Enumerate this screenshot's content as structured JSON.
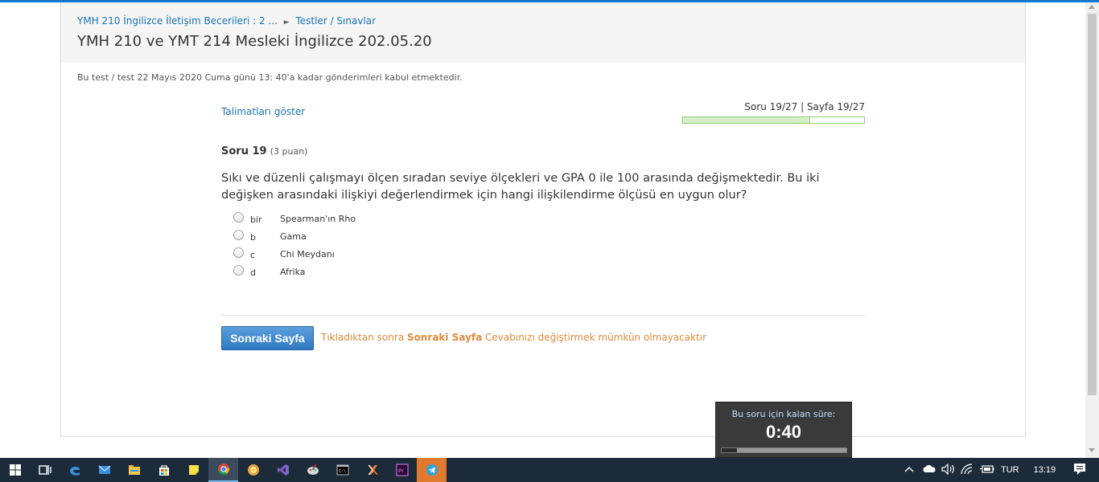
{
  "breadcrumb": {
    "course": "YMH 210 İngilizce İletişim Becerileri : 2 ...",
    "separator": "►",
    "section": "Testler / Sınavlar"
  },
  "page_title": "YMH 210 ve YMT 214 Mesleki İngilizce 202.05.20",
  "notice": "Bu test / test 22 Mayıs 2020 Cuma günü 13: 40'a kadar gönderimleri kabul etmektedir.",
  "instructions_link": "Talimatları göster",
  "progress": {
    "label": "Soru 19/27 | Sayfa 19/27",
    "fraction": 0.7037
  },
  "question": {
    "number_label": "Soru 19",
    "points_label": "(3 puan)",
    "text": "Sıkı ve düzenli çalışmayı ölçen sıradan seviye ölçekleri ve GPA 0 ile 100 arasında değişmektedir. Bu iki değişken arasındaki ilişkiyi değerlendirmek için hangi ilişkilendirme ölçüsü en uygun olur?",
    "options": [
      {
        "letter": "bir",
        "text": "Spearman'ın Rho"
      },
      {
        "letter": "b",
        "text": "Gama"
      },
      {
        "letter": "c",
        "text": "Chi Meydanı"
      },
      {
        "letter": "d",
        "text": "Afrika"
      }
    ]
  },
  "next_button": "Sonraki Sayfa",
  "warning": {
    "prefix": "Tıkladıktan sonra ",
    "emphasis": "Sonraki Sayfa",
    "suffix": " Cevabınızı değiştirmek mümkün olmayacaktır"
  },
  "timer": {
    "label": "Bu soru için kalan süre:",
    "value": "0:40",
    "remaining_fraction": 0.88
  },
  "taskbar": {
    "apps": [
      "start-icon",
      "task-view-icon",
      "edge-icon",
      "mail-icon",
      "file-explorer-icon",
      "store-icon",
      "sticky-notes-icon",
      "chrome-icon",
      "chrome-canary-icon",
      "visual-studio-icon",
      "paint-icon",
      "cmd-icon",
      "xampp-icon",
      "premiere-icon",
      "telegram-icon"
    ],
    "language": "TUR",
    "time": "13:19"
  },
  "colors": {
    "accent": "#1177d1",
    "link": "#1a73b5",
    "warning": "#e08a3c",
    "button": "#2f79c2",
    "progress_fill": "#d4f0c4"
  }
}
